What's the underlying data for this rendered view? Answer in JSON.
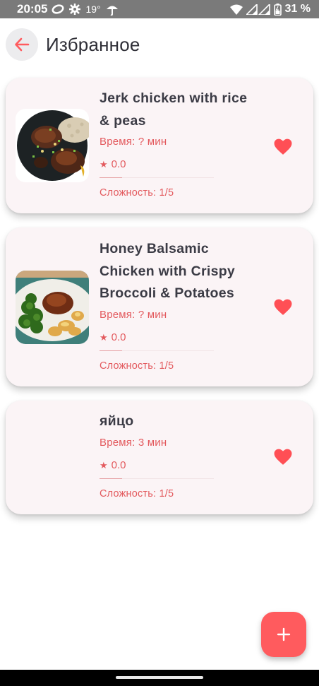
{
  "status_bar": {
    "time": "20:05",
    "temperature": "19°",
    "battery": "31 %",
    "icons": [
      "message-icon",
      "settings-icon",
      "weather-icon",
      "wifi-icon",
      "signal-icon",
      "battery-icon"
    ]
  },
  "header": {
    "title": "Избранное",
    "back_icon": "arrow-left-icon"
  },
  "recipes": [
    {
      "title": "Jerk chicken with rice & peas",
      "time": "Время: ? мин",
      "rating": "0.0",
      "difficulty": "Сложность: 1/5",
      "favorite": true,
      "image": "jerk-chicken-photo"
    },
    {
      "title": "Honey Balsamic Chicken with Crispy Broccoli & Potatoes",
      "time": "Время: ? мин",
      "rating": "0.0",
      "difficulty": "Сложность: 1/5",
      "favorite": true,
      "image": "honey-balsamic-chicken-photo"
    },
    {
      "title": "яйцо",
      "time": "Время: 3 мин",
      "rating": "0.0",
      "difficulty": "Сложность: 1/5",
      "favorite": true,
      "image": null
    }
  ],
  "fab": {
    "icon": "plus-icon"
  },
  "colors": {
    "accent": "#ff5b5e",
    "accent_text": "#e35a5e",
    "card_bg": "#fbf4f6",
    "title_text": "#3b3b45"
  }
}
